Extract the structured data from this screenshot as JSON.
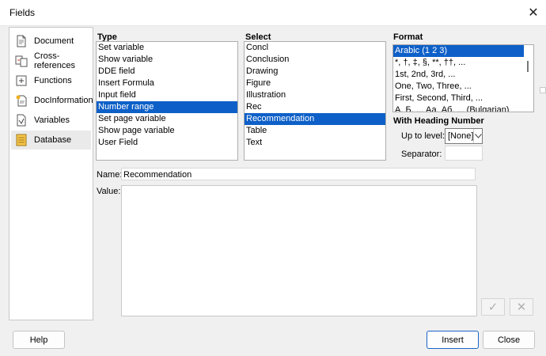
{
  "window": {
    "title": "Fields",
    "close_glyph": "✕"
  },
  "tabs": [
    {
      "label": "Document",
      "icon": "document-icon"
    },
    {
      "label": "Cross-references",
      "icon": "cross-references-icon"
    },
    {
      "label": "Functions",
      "icon": "functions-icon"
    },
    {
      "label": "DocInformation",
      "icon": "docinformation-icon"
    },
    {
      "label": "Variables",
      "icon": "variables-icon",
      "active": true
    },
    {
      "label": "Database",
      "icon": "database-icon"
    }
  ],
  "type": {
    "label": "Type",
    "items": [
      "Set variable",
      "Show variable",
      "DDE field",
      "Insert Formula",
      "Input field",
      "Number range",
      "Set page variable",
      "Show page variable",
      "User Field"
    ],
    "selected": 5
  },
  "select": {
    "label": "Select",
    "items": [
      "Concl",
      "Conclusion",
      "Drawing",
      "Figure",
      "Illustration",
      "Rec",
      "Recommendation",
      "Table",
      "Text"
    ],
    "selected": 6
  },
  "format": {
    "label": "Format",
    "items": [
      "Arabic (1 2 3)",
      "*, †, ‡, §, **, ††, ...",
      "1st, 2nd, 3rd, ...",
      "One, Two, Three, ...",
      "First, Second, Third, ...",
      "А, Б, .., Аа, Аб, ... (Bulgarian)"
    ],
    "selected": 0
  },
  "heading_number": {
    "label": "With Heading Number",
    "up_to_level_label": "Up to level:",
    "up_to_level_value": "[None]",
    "separator_label": "Separator:",
    "separator_value": ""
  },
  "name": {
    "label": "Name:",
    "value": "Recommendation"
  },
  "value": {
    "label": "Value:",
    "value": ""
  },
  "buttons": {
    "help": "Help",
    "insert": "Insert",
    "close": "Close",
    "apply_glyph": "✓",
    "cancel_glyph": "✕"
  },
  "colors": {
    "selection": "#0e60c8",
    "default_border": "#1a64c8"
  }
}
